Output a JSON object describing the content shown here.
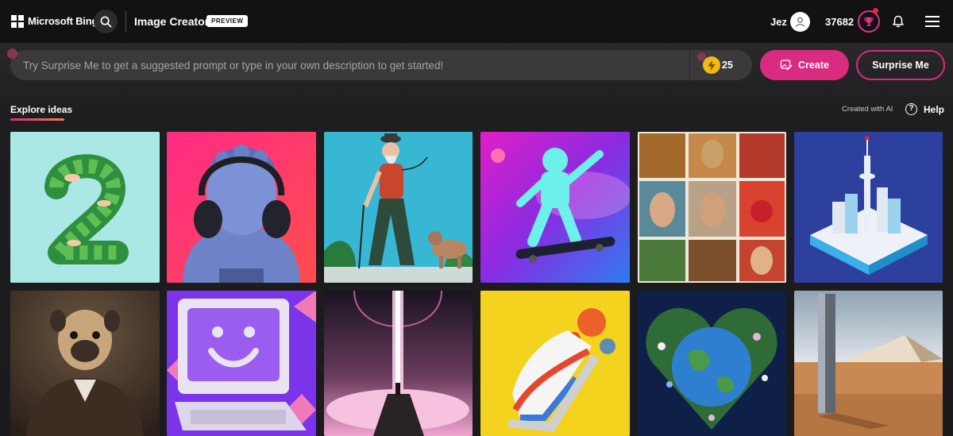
{
  "header": {
    "brand": "Microsoft Bing",
    "app_title": "Image Creator",
    "badge": "PREVIEW",
    "user_name": "Jez",
    "points": "37682"
  },
  "prompt": {
    "placeholder": "Try Surprise Me to get a suggested prompt or type in your own description to get started!",
    "boost_count": "25",
    "create_label": "Create",
    "surprise_label": "Surprise Me"
  },
  "explore": {
    "tab_label": "Explore ideas",
    "created_with_ai": "Created with AI",
    "help_label": "Help"
  },
  "colors": {
    "accent": "#d92b80",
    "boost": "#f2b814",
    "background": "#1b1a1d"
  },
  "gallery": {
    "row1": [
      {
        "name": "number-two-leaves",
        "label": "2"
      },
      {
        "name": "statue-headphones",
        "label": ""
      },
      {
        "name": "old-man-walking-dog",
        "label": ""
      },
      {
        "name": "astronaut-skateboard",
        "label": ""
      },
      {
        "name": "portrait-collage",
        "label": ""
      },
      {
        "name": "isometric-city",
        "label": ""
      }
    ],
    "row2": [
      {
        "name": "pug-portrait",
        "label": ""
      },
      {
        "name": "smiling-computer",
        "label": ""
      },
      {
        "name": "figure-light-beam",
        "label": ""
      },
      {
        "name": "sneaker-splash",
        "label": ""
      },
      {
        "name": "earth-heart-flowers",
        "label": ""
      },
      {
        "name": "desert-monolith",
        "label": ""
      }
    ]
  }
}
